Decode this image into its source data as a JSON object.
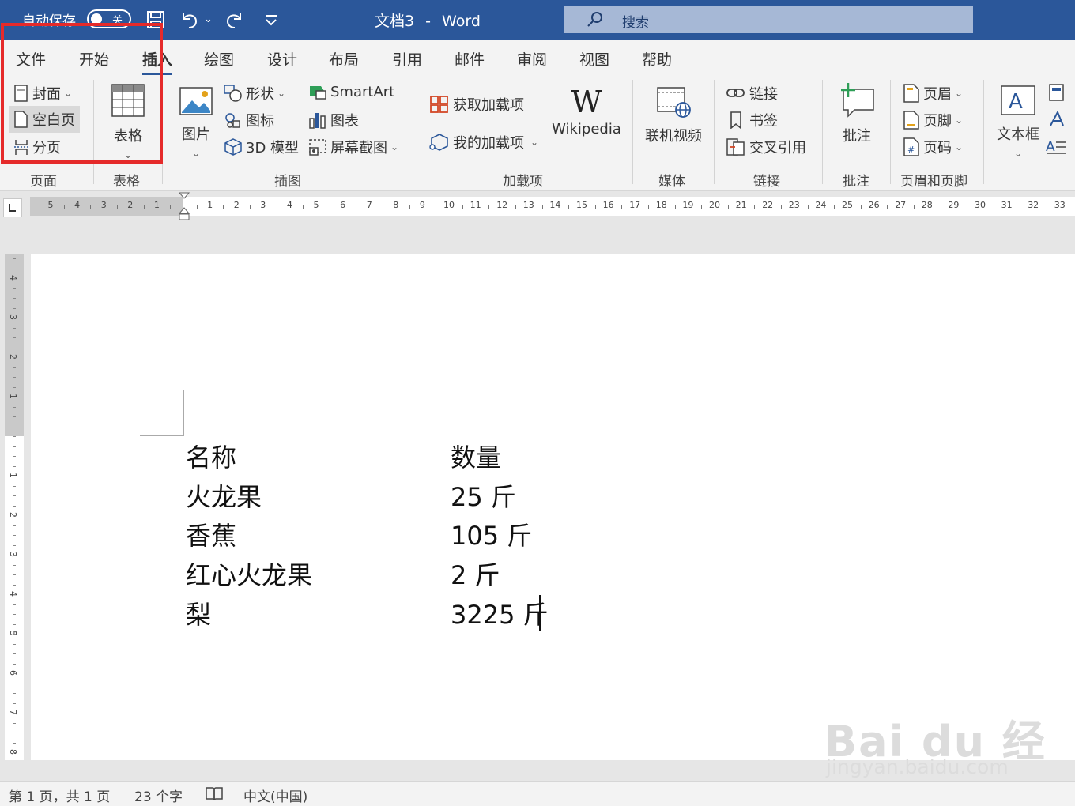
{
  "titlebar": {
    "autosave_label": "自动保存",
    "autosave_state": "关",
    "doc_name": "文档3",
    "separator": "-",
    "app_name": "Word",
    "search_placeholder": "搜索"
  },
  "tabs": [
    {
      "label": "文件"
    },
    {
      "label": "开始"
    },
    {
      "label": "插入"
    },
    {
      "label": "绘图"
    },
    {
      "label": "设计"
    },
    {
      "label": "布局"
    },
    {
      "label": "引用"
    },
    {
      "label": "邮件"
    },
    {
      "label": "审阅"
    },
    {
      "label": "视图"
    },
    {
      "label": "帮助"
    }
  ],
  "active_tab": "插入",
  "ribbon": {
    "pages": {
      "cover": "封面",
      "blank": "空白页",
      "break": "分页",
      "group": "页面"
    },
    "tables": {
      "table": "表格",
      "group": "表格"
    },
    "illustrations": {
      "picture": "图片",
      "shapes": "形状",
      "icons": "图标",
      "model3d": "3D 模型",
      "smartart": "SmartArt",
      "chart": "图表",
      "screenshot": "屏幕截图",
      "group": "插图"
    },
    "addins": {
      "get": "获取加载项",
      "my": "我的加载项",
      "wiki": "Wikipedia",
      "group": "加载项"
    },
    "media": {
      "video": "联机视频",
      "group": "媒体"
    },
    "links": {
      "link": "链接",
      "bookmark": "书签",
      "crossref": "交叉引用",
      "group": "链接"
    },
    "comments": {
      "comment": "批注",
      "group": "批注"
    },
    "headerfooter": {
      "header": "页眉",
      "footer": "页脚",
      "pagenum": "页码",
      "group": "页眉和页脚"
    },
    "text": {
      "textbox": "文本框"
    }
  },
  "ruler": {
    "left_numbers": [
      "5",
      "4",
      "3",
      "2",
      "1"
    ],
    "right_numbers": [
      "1",
      "2",
      "3",
      "4",
      "5",
      "6",
      "7",
      "8",
      "9",
      "10",
      "11",
      "12",
      "13",
      "14",
      "15",
      "16",
      "17",
      "18",
      "19",
      "20",
      "21",
      "22",
      "23",
      "24",
      "25",
      "26",
      "27",
      "28",
      "29",
      "30",
      "31",
      "32",
      "33"
    ]
  },
  "vruler": {
    "numbers": [
      "4",
      "3",
      "2",
      "1",
      "1",
      "2",
      "3",
      "4",
      "5",
      "6",
      "7",
      "8"
    ]
  },
  "document": {
    "rows": [
      {
        "name": "名称",
        "qty": "数量"
      },
      {
        "name": "火龙果",
        "qty": "25 斤"
      },
      {
        "name": "香蕉",
        "qty": "105 斤"
      },
      {
        "name": "红心火龙果",
        "qty": "2 斤"
      },
      {
        "name": "梨",
        "qty": "3225 斤"
      }
    ]
  },
  "watermark": {
    "brand": "Bai du 经验",
    "url": "jingyan.baidu.com"
  },
  "status": {
    "page": "第 1 页，共 1 页",
    "words": "23 个字",
    "language": "中文(中国)"
  },
  "colors": {
    "title_bar": "#2b579a",
    "highlight_box": "#e52a2a",
    "search_box": "#a6b8d6"
  }
}
